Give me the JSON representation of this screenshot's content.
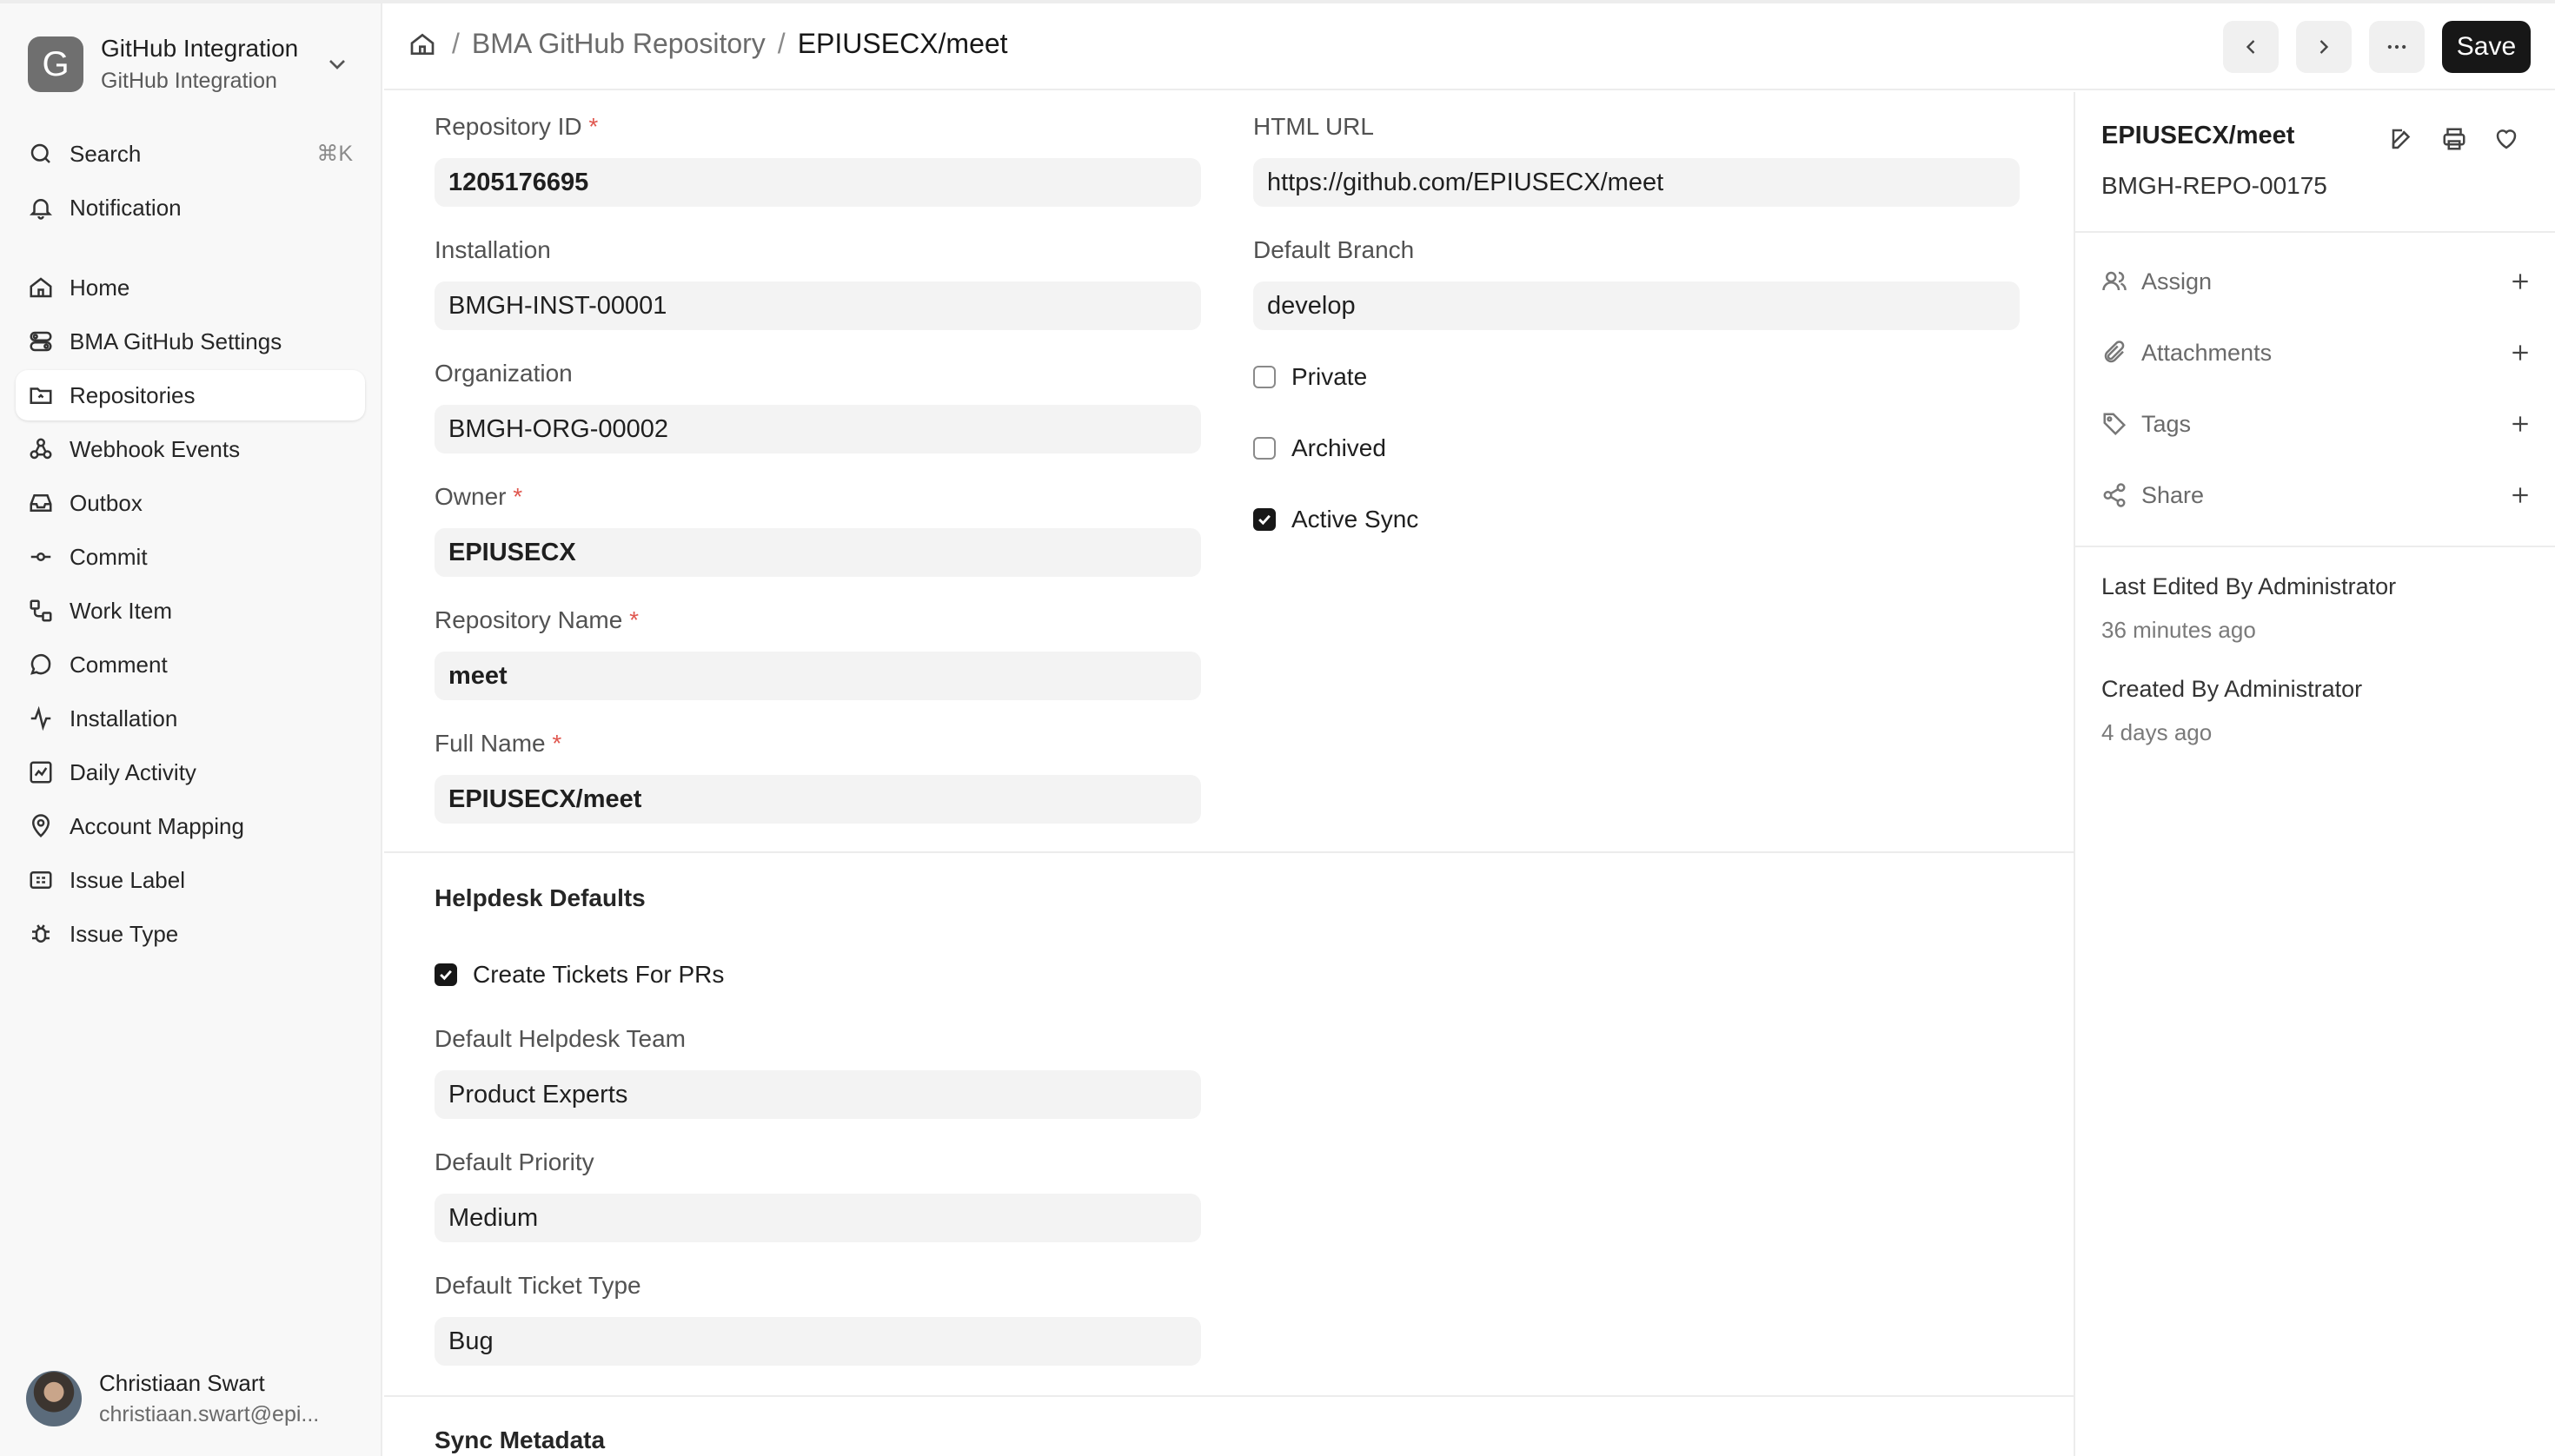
{
  "sidebar": {
    "app_initial": "G",
    "app_title": "GitHub Integration",
    "app_subtitle": "GitHub Integration",
    "search_label": "Search",
    "search_shortcut": "⌘K",
    "notification_label": "Notification",
    "items": [
      {
        "label": "Home",
        "icon": "home-icon"
      },
      {
        "label": "BMA GitHub Settings",
        "icon": "settings-toggle-icon"
      },
      {
        "label": "Repositories",
        "icon": "folder-icon",
        "active": true
      },
      {
        "label": "Webhook Events",
        "icon": "webhook-icon"
      },
      {
        "label": "Outbox",
        "icon": "inbox-icon"
      },
      {
        "label": "Commit",
        "icon": "commit-icon"
      },
      {
        "label": "Work Item",
        "icon": "workflow-icon"
      },
      {
        "label": "Comment",
        "icon": "comment-icon"
      },
      {
        "label": "Installation",
        "icon": "activity-icon"
      },
      {
        "label": "Daily Activity",
        "icon": "chart-icon"
      },
      {
        "label": "Account Mapping",
        "icon": "map-pin-icon"
      },
      {
        "label": "Issue Label",
        "icon": "label-icon"
      },
      {
        "label": "Issue Type",
        "icon": "bug-icon"
      }
    ],
    "user": {
      "name": "Christiaan Swart",
      "email": "christiaan.swart@epi..."
    }
  },
  "header": {
    "breadcrumb_parent": "BMA GitHub Repository",
    "breadcrumb_current": "EPIUSECX/meet",
    "save_label": "Save"
  },
  "form": {
    "repository_id": {
      "label": "Repository ID",
      "value": "1205176695",
      "required": "*"
    },
    "installation": {
      "label": "Installation",
      "value": "BMGH-INST-00001"
    },
    "organization": {
      "label": "Organization",
      "value": "BMGH-ORG-00002"
    },
    "owner": {
      "label": "Owner",
      "value": "EPIUSECX",
      "required": "*"
    },
    "repository_name": {
      "label": "Repository Name",
      "value": "meet",
      "required": "*"
    },
    "full_name": {
      "label": "Full Name",
      "value": "EPIUSECX/meet",
      "required": "*"
    },
    "html_url": {
      "label": "HTML URL",
      "value": "https://github.com/EPIUSECX/meet"
    },
    "default_branch": {
      "label": "Default Branch",
      "value": "develop"
    },
    "private": {
      "label": "Private",
      "checked": false
    },
    "archived": {
      "label": "Archived",
      "checked": false
    },
    "active_sync": {
      "label": "Active Sync",
      "checked": true
    },
    "helpdesk_section": "Helpdesk Defaults",
    "create_tickets": {
      "label": "Create Tickets For PRs",
      "checked": true
    },
    "helpdesk_team": {
      "label": "Default Helpdesk Team",
      "value": "Product Experts"
    },
    "priority": {
      "label": "Default Priority",
      "value": "Medium"
    },
    "ticket_type": {
      "label": "Default Ticket Type",
      "value": "Bug"
    },
    "sync_section": "Sync Metadata"
  },
  "panel": {
    "title": "EPIUSECX/meet",
    "doc_id": "BMGH-REPO-00175",
    "assign": "Assign",
    "attachments": "Attachments",
    "tags": "Tags",
    "share": "Share",
    "last_edited": "Last Edited By Administrator",
    "last_edited_time": "36 minutes ago",
    "created": "Created By Administrator",
    "created_time": "4 days ago"
  }
}
